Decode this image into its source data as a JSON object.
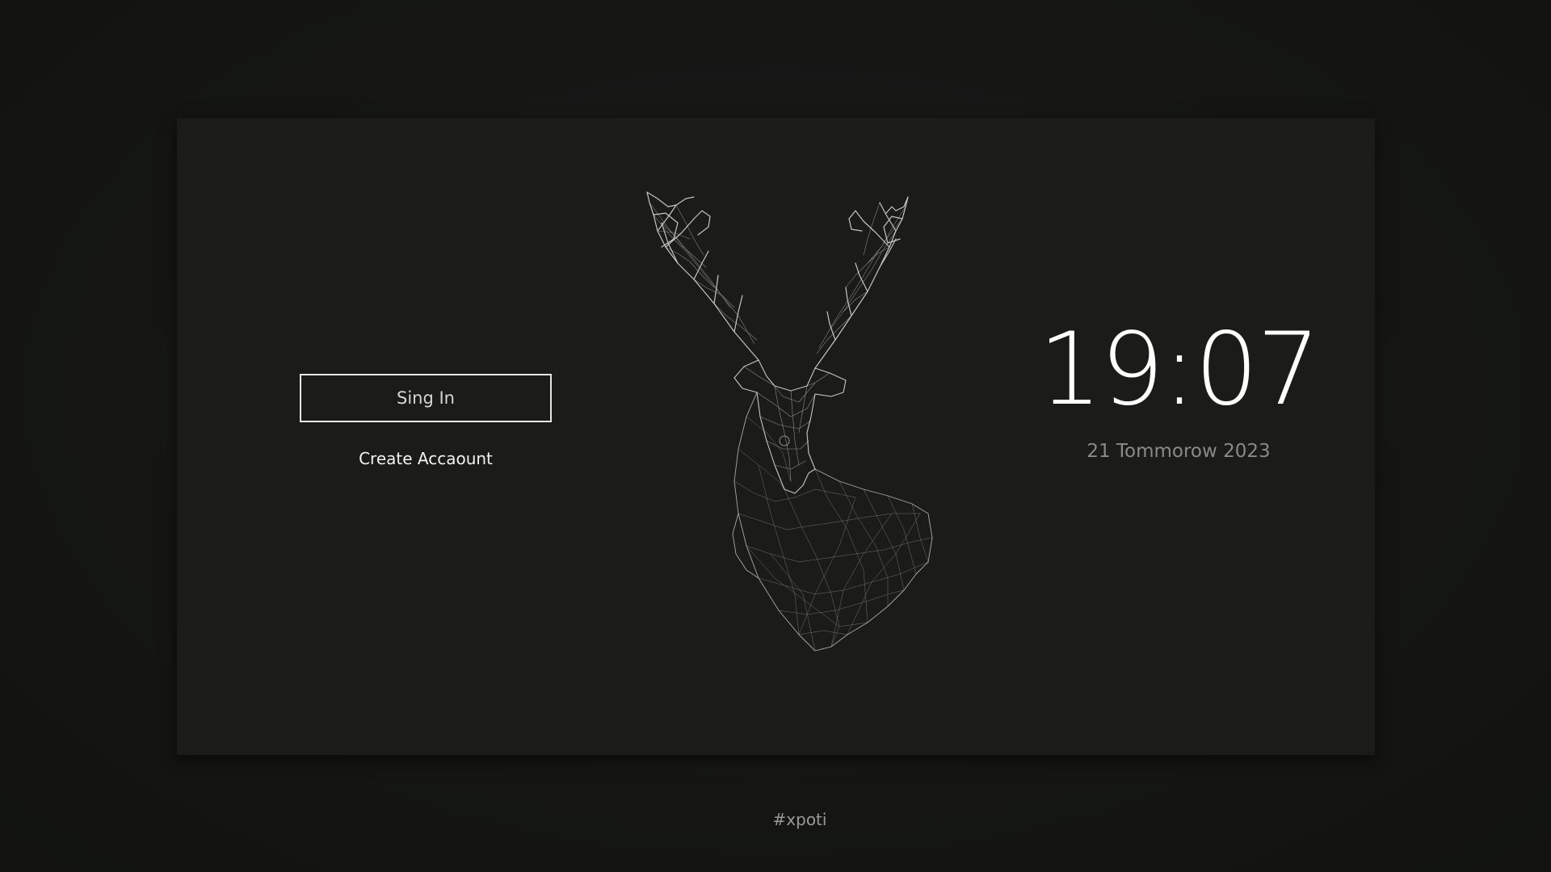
{
  "login": {
    "signin_label": "Sing In",
    "create_account_label": "Create Accaount"
  },
  "clock": {
    "time": "19:07",
    "date": "21 Tommorow 2023"
  },
  "footer": {
    "tag": "#xpoti"
  },
  "art": {
    "icon": "deer-head-wireframe-icon"
  },
  "colors": {
    "background": "#131412",
    "card": "#1b1b1a",
    "text_primary": "#ffffff",
    "text_secondary": "#8a8a8a"
  }
}
